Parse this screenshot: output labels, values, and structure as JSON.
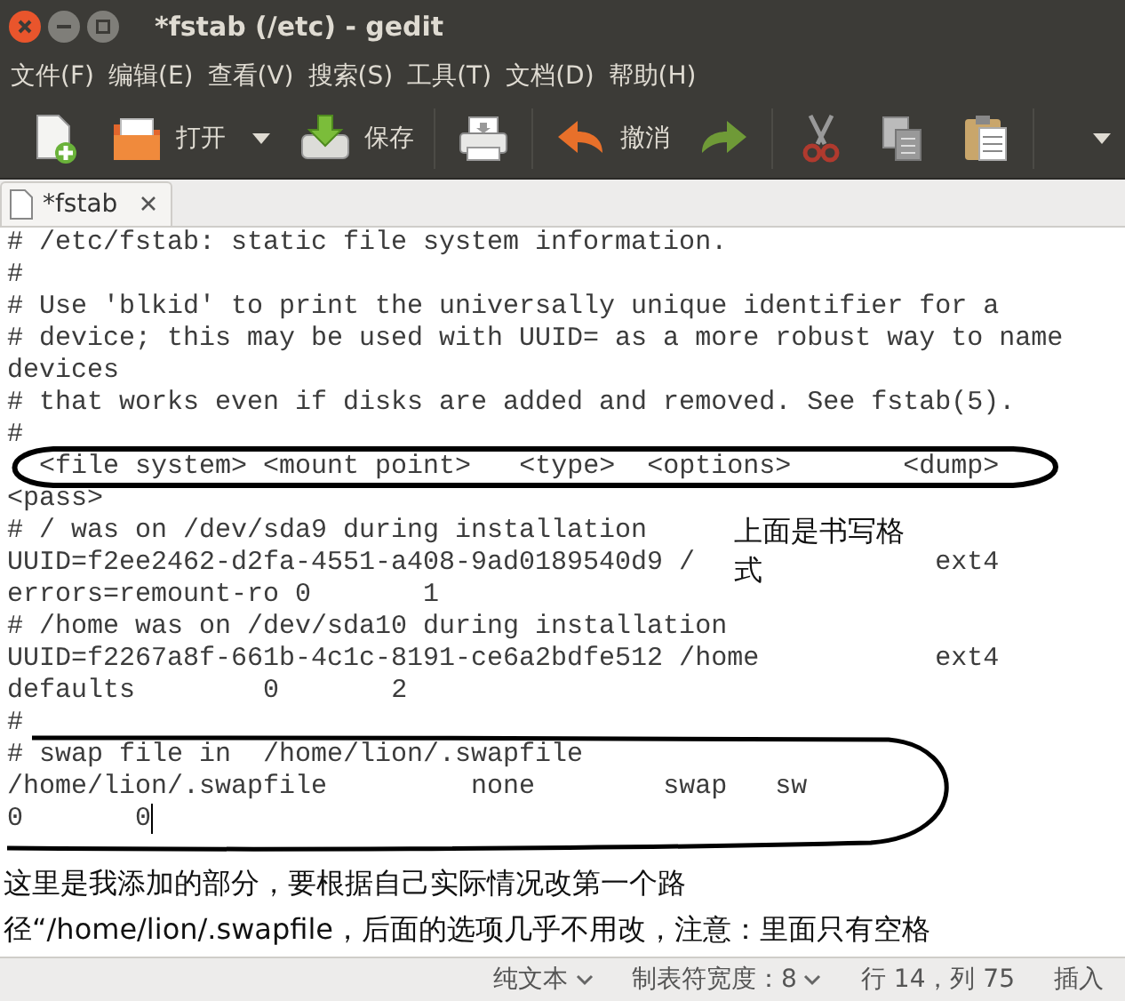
{
  "window": {
    "title": "*fstab (/etc) - gedit"
  },
  "menu": [
    "文件(F)",
    "编辑(E)",
    "查看(V)",
    "搜索(S)",
    "工具(T)",
    "文档(D)",
    "帮助(H)"
  ],
  "toolbar": [
    {
      "kind": "new"
    },
    {
      "kind": "open",
      "label": "打开"
    },
    {
      "kind": "dropdown"
    },
    {
      "kind": "save",
      "label": "保存"
    },
    {
      "kind": "print"
    },
    {
      "kind": "undo",
      "label": "撤消"
    },
    {
      "kind": "redo"
    },
    {
      "kind": "cut"
    },
    {
      "kind": "copy"
    },
    {
      "kind": "paste"
    },
    {
      "kind": "overflow"
    }
  ],
  "tabs": [
    {
      "label": "*fstab",
      "selected": true
    }
  ],
  "editor": {
    "lines": [
      "# /etc/fstab: static file system information.",
      "#",
      "# Use 'blkid' to print the universally unique identifier for a",
      "# device; this may be used with UUID= as a more robust way to name",
      "devices",
      "# that works even if disks are added and removed. See fstab(5).",
      "#",
      "  <file system> <mount point>   <type>  <options>       <dump>",
      "<pass>",
      "# / was on /dev/sda9 during installation",
      "UUID=f2ee2462-d2fa-4551-a408-9ad0189540d9 /               ext4",
      "errors=remount-ro 0       1",
      "# /home was on /dev/sda10 during installation",
      "UUID=f2267a8f-661b-4c1c-8191-ce6a2bdfe512 /home           ext4",
      "defaults        0       2",
      "#",
      "# swap file in  /home/lion/.swapfile",
      "/home/lion/.swapfile         none        swap   sw",
      "0       0"
    ]
  },
  "annotations": [
    {
      "kind": "side",
      "text": "上面是书写格式"
    },
    {
      "kind": "bottom",
      "text": "这里是我添加的部分，要根据自己实际情况改第一个路径“/home/lion/.swapfile，后面的选项几乎不用改，注意：里面只有空格"
    }
  ],
  "status_bar": [
    {
      "label": "纯文本",
      "dropdown": true
    },
    {
      "label": "制表符宽度：8",
      "dropdown": true
    },
    {
      "label": "行 14，列 75",
      "dropdown": false
    },
    {
      "label": "插入",
      "dropdown": false
    }
  ]
}
